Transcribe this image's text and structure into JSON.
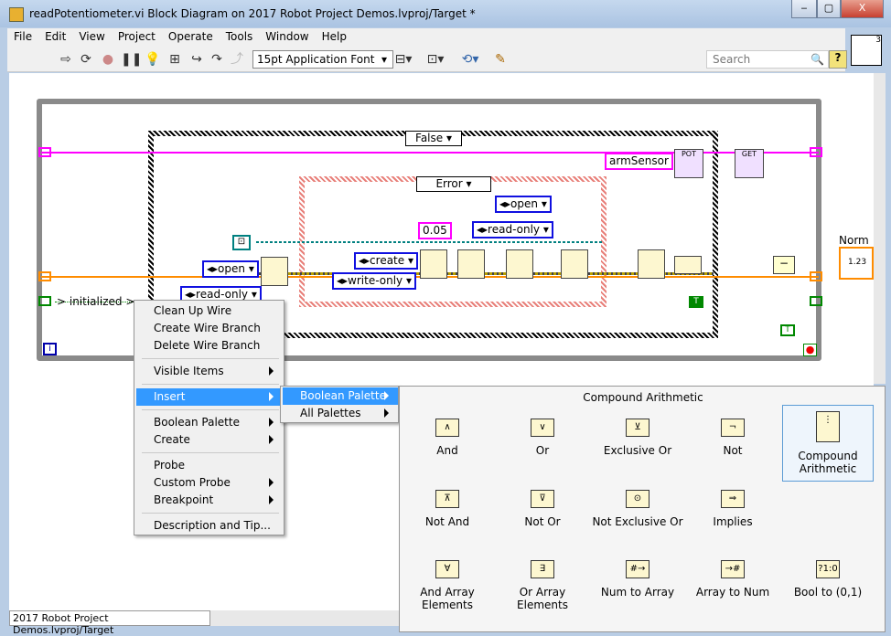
{
  "window": {
    "title": "readPotentiometer.vi Block Diagram on 2017 Robot Project Demos.lvproj/Target *",
    "minimize": "‒",
    "maximize": "▢",
    "close": "X"
  },
  "menubar": [
    "File",
    "Edit",
    "View",
    "Project",
    "Operate",
    "Tools",
    "Window",
    "Help"
  ],
  "toolbar": {
    "font": "15pt Application Font",
    "search_placeholder": "Search",
    "help": "?",
    "vi_icon_count": "3"
  },
  "diagram": {
    "case_selector": "False",
    "error_selector": "Error",
    "enums": {
      "open1": "open",
      "readonly1": "read-only",
      "create": "create",
      "writeonly": "write-only",
      "open2": "open",
      "readonly2": "read-only"
    },
    "constant": "0.05",
    "arm_sensor": "armSensor",
    "pot": "POT",
    "get": "GET",
    "initialized": "> initialized >",
    "norm": "Norm",
    "display": "1.23",
    "true1": "T",
    "true2": "T",
    "info": "i"
  },
  "context_menu": {
    "items": [
      "Clean Up Wire",
      "Create Wire Branch",
      "Delete Wire Branch",
      "Visible Items",
      "Insert",
      "Boolean Palette",
      "Create",
      "Probe",
      "Custom Probe",
      "Breakpoint",
      "Description and Tip..."
    ]
  },
  "submenu": {
    "items": [
      "Boolean Palette",
      "All Palettes"
    ]
  },
  "palette": {
    "title": "Compound Arithmetic",
    "items": [
      {
        "label": "And",
        "icon": "and-icon"
      },
      {
        "label": "Or",
        "icon": "or-icon"
      },
      {
        "label": "Exclusive Or",
        "icon": "xor-icon"
      },
      {
        "label": "Not",
        "icon": "not-icon"
      },
      {
        "label": "Compound Arithmetic",
        "icon": "compound-arithmetic-icon"
      },
      {
        "label": "Not And",
        "icon": "nand-icon"
      },
      {
        "label": "Not Or",
        "icon": "nor-icon"
      },
      {
        "label": "Not Exclusive Or",
        "icon": "xnor-icon"
      },
      {
        "label": "Implies",
        "icon": "implies-icon"
      },
      {
        "label": "And Array Elements",
        "icon": "and-array-icon"
      },
      {
        "label": "Or Array Elements",
        "icon": "or-array-icon"
      },
      {
        "label": "Num to Array",
        "icon": "num-to-array-icon"
      },
      {
        "label": "Array to Num",
        "icon": "array-to-num-icon"
      },
      {
        "label": "Bool to (0,1)",
        "icon": "bool-to-01-icon"
      }
    ]
  },
  "status": {
    "project": "2017 Robot Project Demos.lvproj/Target"
  },
  "colors": {
    "highlight": "#3399ff",
    "boolean_wire": "#008000",
    "enum_border": "#1010e0",
    "error_case": "#e8807a",
    "refnum_wire": "#ff00ff"
  }
}
